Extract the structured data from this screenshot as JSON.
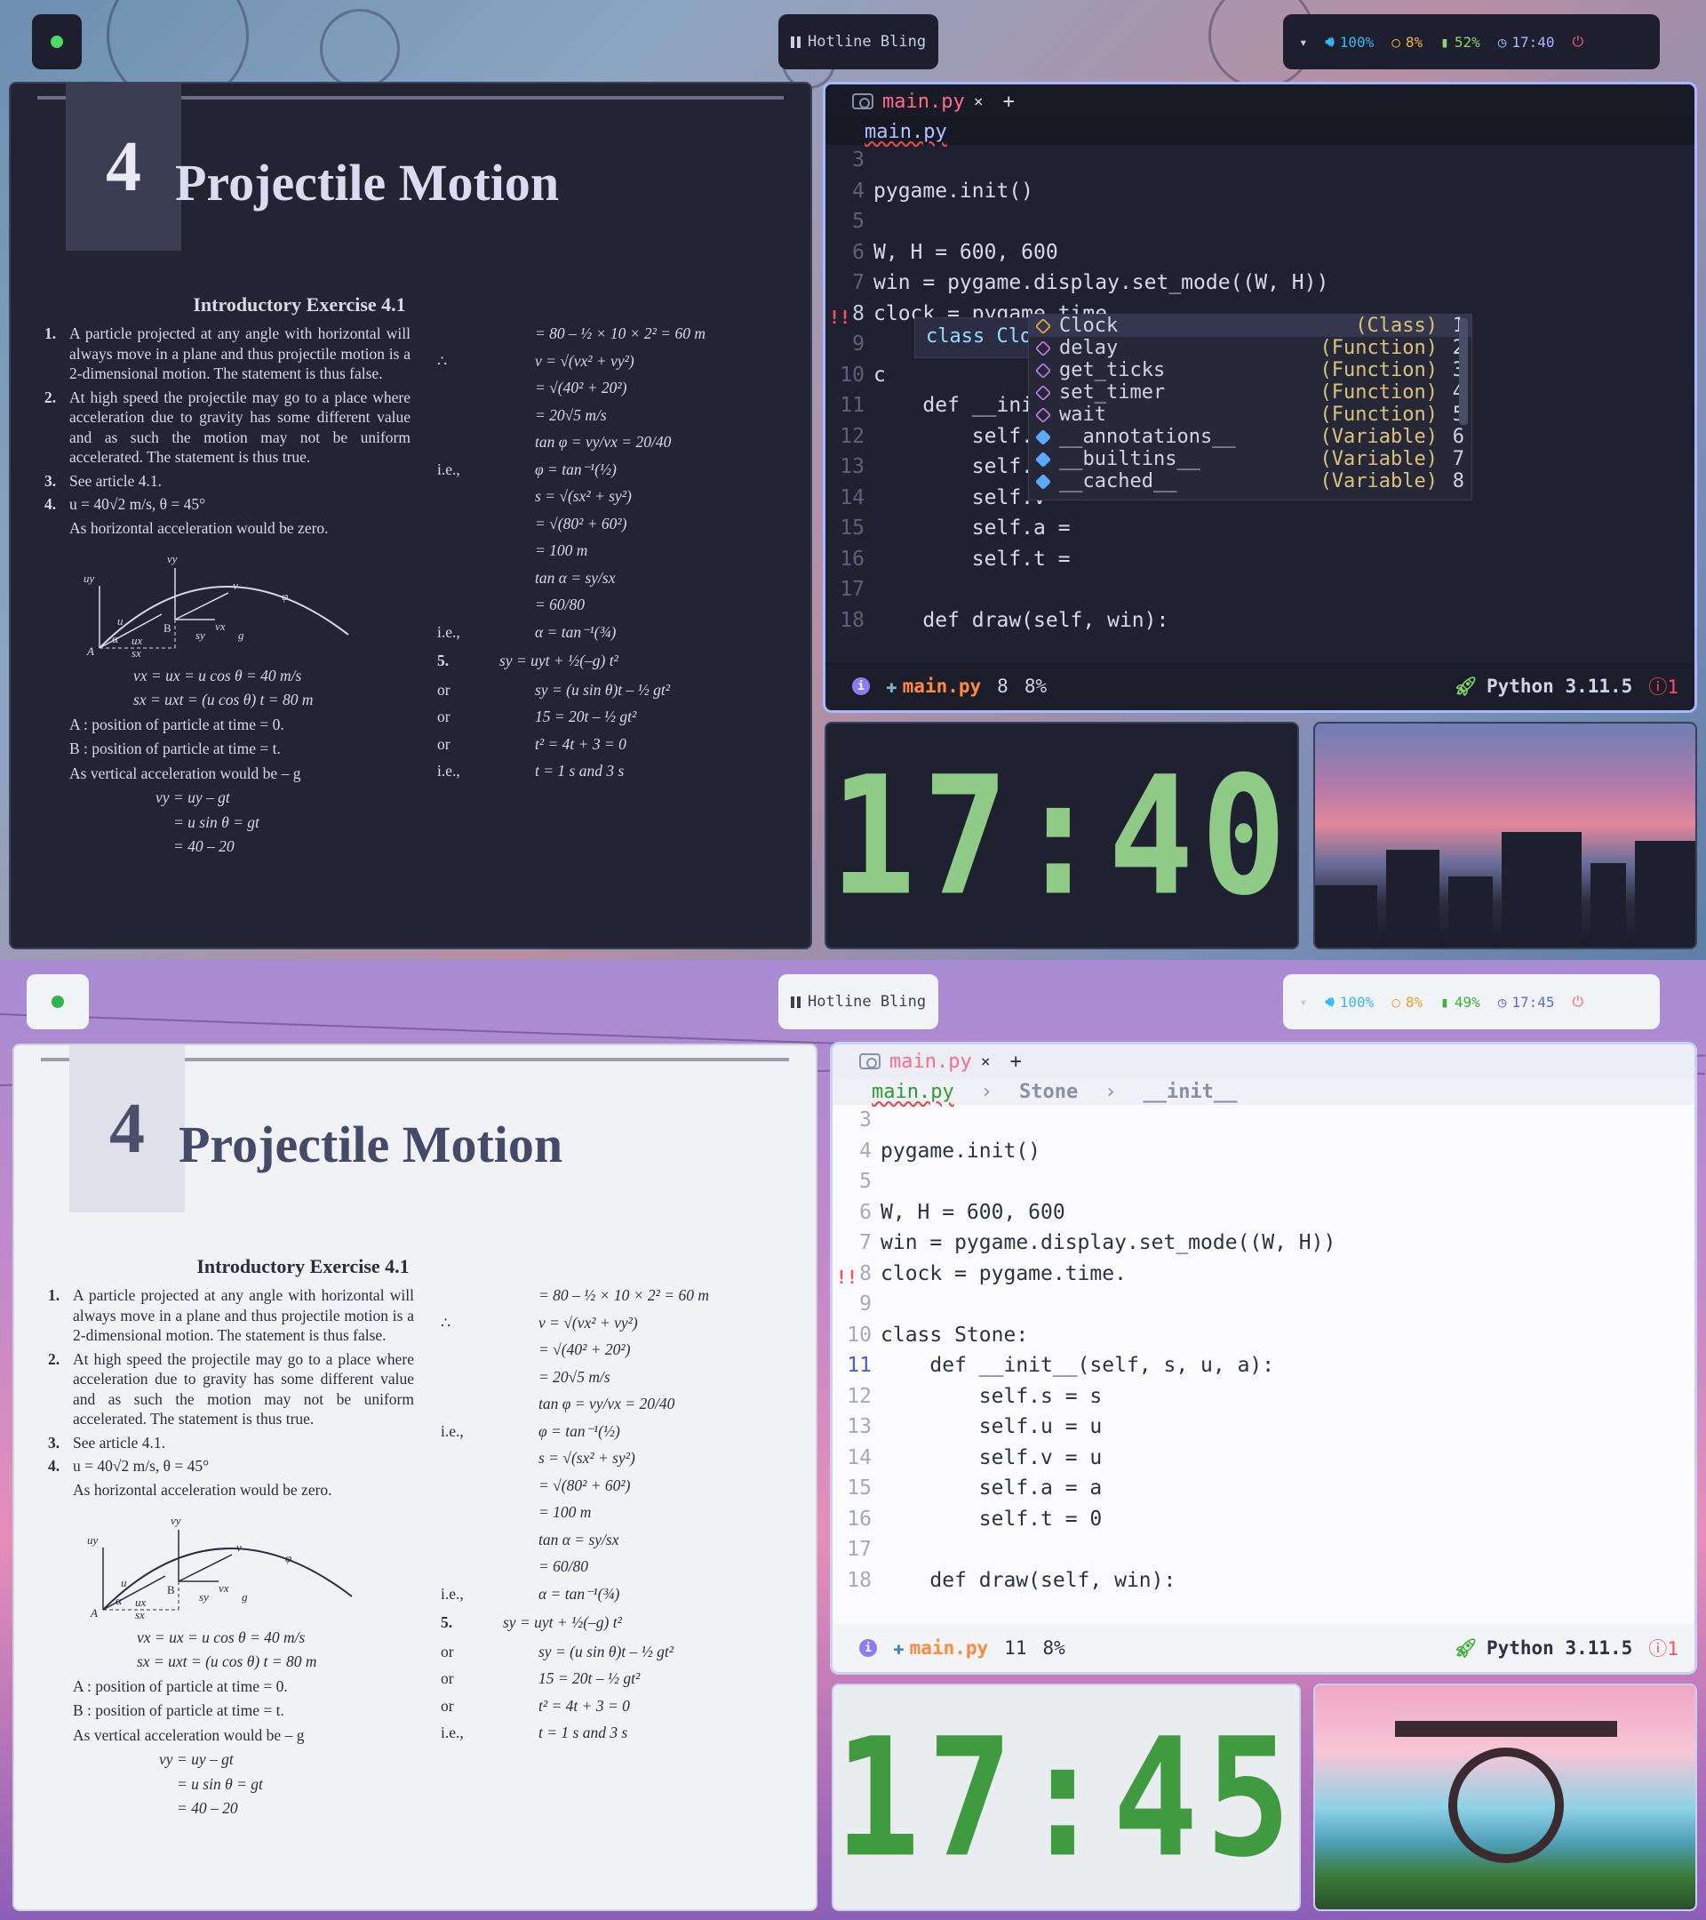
{
  "top": {
    "bar": {
      "window_title": "Hotline Bling",
      "status": {
        "volume": "100%",
        "cpu": "8%",
        "battery": "52%",
        "time": "17:40"
      }
    },
    "editor": {
      "tab_name": "main.py",
      "tab_close": "×",
      "tab_add": "+",
      "breadcrumb": [
        "main.py"
      ],
      "status": {
        "file": "main.py",
        "line": "8",
        "percent": "8%",
        "python": "Python 3.11.5",
        "errors": "1"
      },
      "signature": "class Clock()",
      "completions": [
        {
          "label": "Clock",
          "kind": "(Class)",
          "index": "1",
          "icon": "class-icon"
        },
        {
          "label": "delay",
          "kind": "(Function)",
          "index": "2",
          "icon": "function-icon"
        },
        {
          "label": "get_ticks",
          "kind": "(Function)",
          "index": "3",
          "icon": "function-icon"
        },
        {
          "label": "set_timer",
          "kind": "(Function)",
          "index": "4",
          "icon": "function-icon"
        },
        {
          "label": "wait",
          "kind": "(Function)",
          "index": "5",
          "icon": "function-icon"
        },
        {
          "label": "__annotations__",
          "kind": "(Variable)",
          "index": "6",
          "icon": "variable-icon"
        },
        {
          "label": "__builtins__",
          "kind": "(Variable)",
          "index": "7",
          "icon": "variable-icon"
        },
        {
          "label": "__cached__",
          "kind": "(Variable)",
          "index": "8",
          "icon": "variable-icon"
        }
      ]
    },
    "clock": "17:40"
  },
  "bottom": {
    "bar": {
      "window_title": "Hotline Bling",
      "status": {
        "volume": "100%",
        "cpu": "8%",
        "battery": "49%",
        "time": "17:45"
      }
    },
    "editor": {
      "tab_name": "main.py",
      "tab_close": "×",
      "tab_add": "+",
      "breadcrumb": [
        "main.py",
        "Stone",
        "__init__"
      ],
      "status": {
        "file": "main.py",
        "line": "11",
        "percent": "8%",
        "python": "Python 3.11.5",
        "errors": "1"
      }
    },
    "clock": "17:45"
  },
  "code_top": [
    {
      "no": "3",
      "text": ""
    },
    {
      "no": "4",
      "text": "pygame.init()"
    },
    {
      "no": "5",
      "text": ""
    },
    {
      "no": "6",
      "text": "W, H = 600, 600"
    },
    {
      "no": "7",
      "text": "win = pygame.display.set_mode((W, H))"
    },
    {
      "no": "8",
      "text": "clock = pygame.time."
    },
    {
      "no": "9",
      "text": ""
    },
    {
      "no": "10",
      "text": "c"
    },
    {
      "no": "11",
      "text": "    def __init__("
    },
    {
      "no": "12",
      "text": "        self.s ="
    },
    {
      "no": "13",
      "text": "        self.u ="
    },
    {
      "no": "14",
      "text": "        self.v ="
    },
    {
      "no": "15",
      "text": "        self.a ="
    },
    {
      "no": "16",
      "text": "        self.t ="
    },
    {
      "no": "17",
      "text": ""
    },
    {
      "no": "18",
      "text": "    def draw(self, win):"
    }
  ],
  "code_bottom": [
    {
      "no": "3",
      "text": ""
    },
    {
      "no": "4",
      "text": "pygame.init()"
    },
    {
      "no": "5",
      "text": ""
    },
    {
      "no": "6",
      "text": "W, H = 600, 600"
    },
    {
      "no": "7",
      "text": "win = pygame.display.set_mode((W, H))"
    },
    {
      "no": "8",
      "text": "clock = pygame.time."
    },
    {
      "no": "9",
      "text": ""
    },
    {
      "no": "10",
      "text": "class Stone:"
    },
    {
      "no": "11",
      "text": "    def __init__(self, s, u, a):"
    },
    {
      "no": "12",
      "text": "        self.s = s"
    },
    {
      "no": "13",
      "text": "        self.u = u"
    },
    {
      "no": "14",
      "text": "        self.v = u"
    },
    {
      "no": "15",
      "text": "        self.a = a"
    },
    {
      "no": "16",
      "text": "        self.t = 0"
    },
    {
      "no": "17",
      "text": ""
    },
    {
      "no": "18",
      "text": "    def draw(self, win):"
    }
  ],
  "pdf": {
    "chapter_number": "4",
    "chapter_title": "Projectile Motion",
    "exercise_heading": "Introductory Exercise 4.1",
    "items": [
      {
        "n": "1.",
        "text": "A particle projected at any angle with horizontal will always move in a plane and thus projectile motion is a 2-dimensional motion. The statement is thus false."
      },
      {
        "n": "2.",
        "text": "At high speed the projectile may go to a place where acceleration due to gravity has some different value and as such the motion may not be uniform accelerated. The statement is thus true."
      },
      {
        "n": "3.",
        "text": "See article 4.1."
      },
      {
        "n": "4.",
        "text": "u = 40√2 m/s, θ = 45°"
      }
    ],
    "item4_note": "As horizontal acceleration would be zero.",
    "left_eqs": [
      "vx = ux = u cos θ = 40 m/s",
      "sx = uxt = (u cos θ) t = 80 m"
    ],
    "left_notes": [
      "A : position of particle at time = 0.",
      "B : position of particle at time = t.",
      "As vertical acceleration would be – g"
    ],
    "left_eqs2": [
      "vy = uy – gt",
      "= u sin θ = gt",
      "= 40 – 20"
    ],
    "right_eqs": [
      {
        "pre": "",
        "eq": "= 80 – ½ × 10 × 2² = 60 m"
      },
      {
        "pre": "∴",
        "eq": "v = √(vx² + vy²)"
      },
      {
        "pre": "",
        "eq": "= √(40² + 20²)"
      },
      {
        "pre": "",
        "eq": "= 20√5 m/s"
      },
      {
        "pre": "",
        "eq": "tan φ = vy/vx = 20/40"
      },
      {
        "pre": "i.e.,",
        "eq": "φ = tan⁻¹(½)"
      },
      {
        "pre": "",
        "eq": "s = √(sx² + sy²)"
      },
      {
        "pre": "",
        "eq": "= √(80² + 60²)"
      },
      {
        "pre": "",
        "eq": "= 100 m"
      },
      {
        "pre": "",
        "eq": "tan α = sy/sx"
      },
      {
        "pre": "",
        "eq": "= 60/80"
      },
      {
        "pre": "i.e.,",
        "eq": "α = tan⁻¹(¾)"
      },
      {
        "pre": "5.",
        "eq": "sy = uyt + ½(–g) t²"
      },
      {
        "pre": "or",
        "eq": "sy = (u sin θ)t – ½ gt²"
      },
      {
        "pre": "or",
        "eq": "15 = 20t – ½ gt²"
      },
      {
        "pre": "or",
        "eq": "t² = 4t + 3 = 0"
      },
      {
        "pre": "i.e.,",
        "eq": "t = 1 s and 3 s"
      }
    ],
    "diagram_labels": {
      "uy": "uy",
      "u": "u",
      "vy": "vy",
      "v": "v",
      "phi": "φ",
      "vx": "vx",
      "B": "B",
      "A": "A",
      "alpha": "α",
      "ux": "ux",
      "sx": "sx",
      "sy": "sy",
      "g": "g"
    }
  }
}
